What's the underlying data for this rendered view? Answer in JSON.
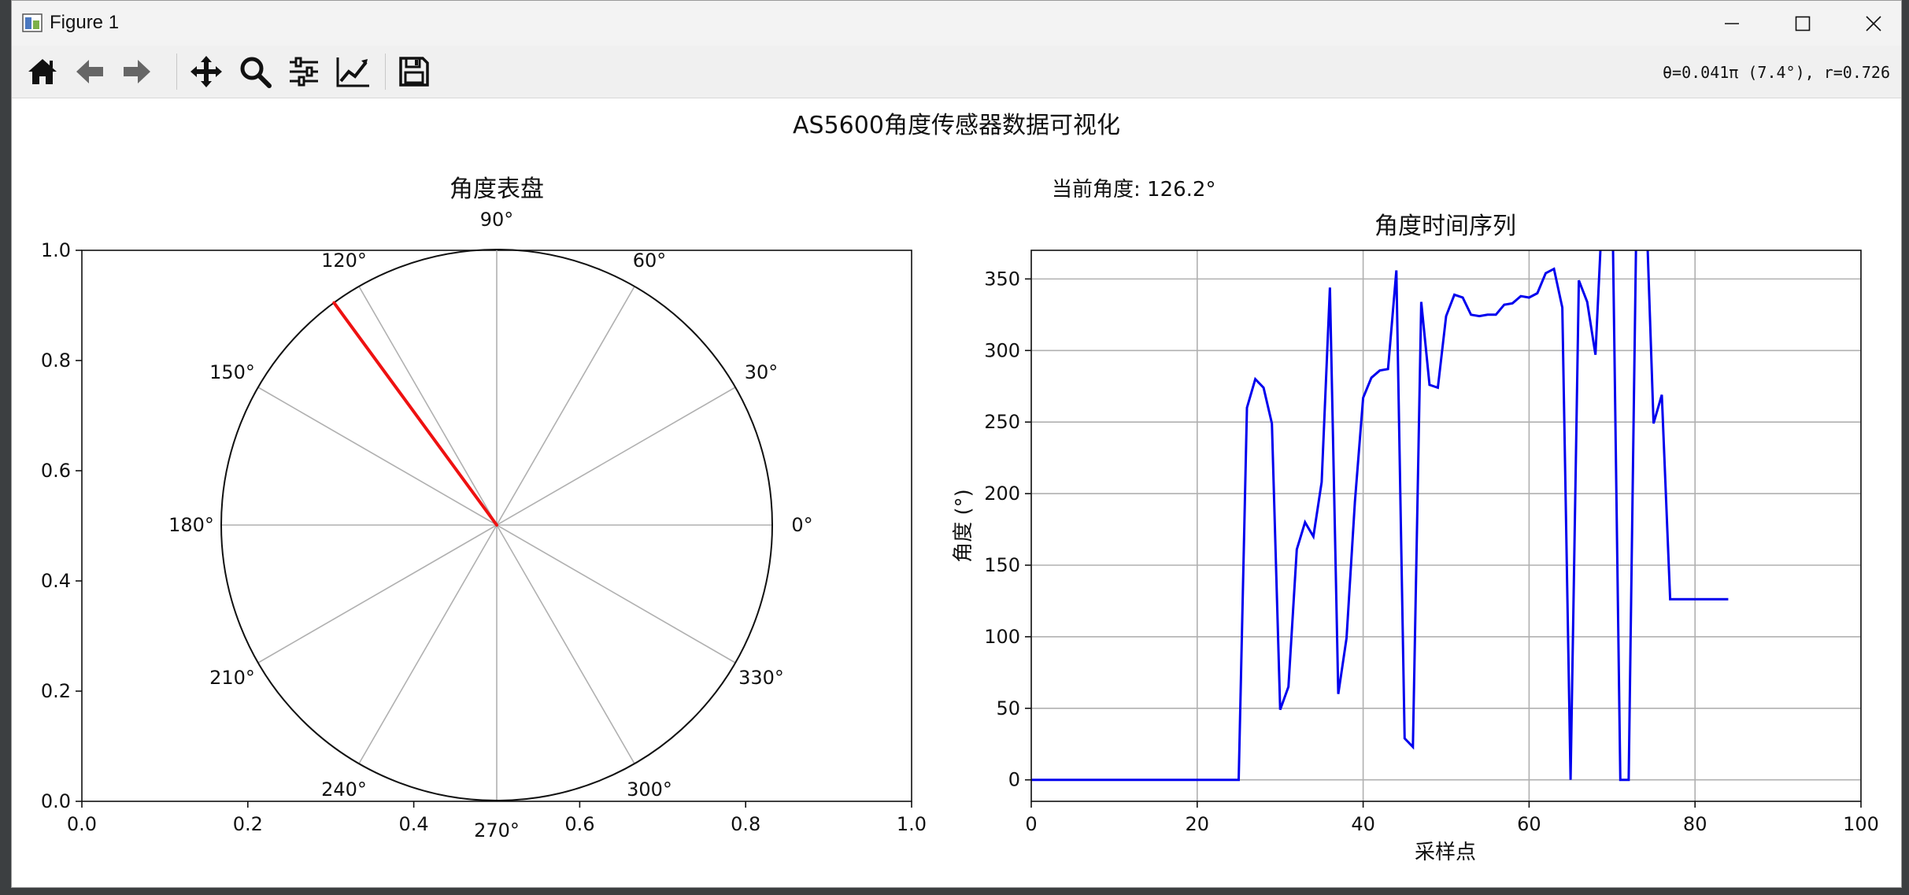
{
  "window": {
    "title": "Figure 1",
    "controls": {
      "minimize": "minimize",
      "maximize": "maximize",
      "close": "close"
    }
  },
  "toolbar": {
    "buttons": [
      {
        "name": "home-button",
        "icon": "home-icon"
      },
      {
        "name": "back-button",
        "icon": "arrow-left-icon"
      },
      {
        "name": "forward-button",
        "icon": "arrow-right-icon"
      },
      {
        "name": "pan-button",
        "icon": "move-icon"
      },
      {
        "name": "zoom-button",
        "icon": "magnifier-icon"
      },
      {
        "name": "subplots-button",
        "icon": "sliders-icon"
      },
      {
        "name": "axes-edit-button",
        "icon": "line-chart-icon"
      },
      {
        "name": "save-button",
        "icon": "floppy-disk-icon"
      }
    ],
    "coordinates": "θ=0.041π (7.4°), r=0.726"
  },
  "figure": {
    "suptitle": "AS5600角度传感器数据可视化",
    "current_angle_text": "当前角度: 126.2°"
  },
  "chart_data": [
    {
      "type": "polar-dial",
      "title": "角度表盘",
      "outer_axes_ticks": {
        "x": [
          "0.0",
          "0.2",
          "0.4",
          "0.6",
          "0.8",
          "1.0"
        ],
        "y": [
          "0.0",
          "0.2",
          "0.4",
          "0.6",
          "0.8",
          "1.0"
        ]
      },
      "angle_labels": [
        "0°",
        "30°",
        "60°",
        "90°",
        "120°",
        "150°",
        "180°",
        "210°",
        "240°",
        "270°",
        "300°",
        "330°"
      ],
      "angle_label_values": [
        0,
        30,
        60,
        90,
        120,
        150,
        180,
        210,
        240,
        270,
        300,
        330
      ],
      "radial_grid_angles": [
        0,
        30,
        60,
        90,
        120,
        150,
        180,
        210,
        240,
        270,
        300,
        330
      ],
      "needle": {
        "angle_deg": 126.2,
        "color": "#ee1111"
      },
      "grid": true
    },
    {
      "type": "line",
      "title": "角度时间序列",
      "xlabel": "采样点",
      "ylabel": "角度 (°)",
      "xlim": [
        0,
        100
      ],
      "ylim": [
        -15,
        370
      ],
      "xticks": [
        0,
        20,
        40,
        60,
        80,
        100
      ],
      "yticks": [
        0,
        50,
        100,
        150,
        200,
        250,
        300,
        350
      ],
      "grid": true,
      "series": [
        {
          "color": "#0000ee",
          "x": [
            0,
            1,
            2,
            3,
            4,
            5,
            6,
            7,
            8,
            9,
            10,
            11,
            12,
            13,
            14,
            15,
            16,
            17,
            18,
            19,
            20,
            21,
            22,
            23,
            24,
            25,
            26,
            27,
            28,
            29,
            30,
            31,
            32,
            33,
            34,
            35,
            36,
            37,
            38,
            39,
            40,
            41,
            42,
            43,
            44,
            45,
            46,
            47,
            48,
            49,
            50,
            51,
            52,
            53,
            54,
            55,
            56,
            57,
            58,
            59,
            60,
            61,
            62,
            63,
            64,
            65,
            66,
            67,
            68,
            69,
            70,
            71,
            72,
            73,
            74,
            75,
            76,
            77,
            78,
            79,
            80,
            81,
            82,
            83,
            84
          ],
          "y": [
            0,
            0,
            0,
            0,
            0,
            0,
            0,
            0,
            0,
            0,
            0,
            0,
            0,
            0,
            0,
            0,
            0,
            0,
            0,
            0,
            0,
            0,
            0,
            0,
            0,
            0,
            260,
            280,
            274,
            249,
            49,
            65,
            161,
            180,
            170,
            208,
            344,
            60,
            99,
            194,
            267,
            281,
            286,
            287,
            356,
            29,
            23,
            334,
            276,
            274,
            324,
            339,
            337,
            325,
            324,
            325,
            325,
            332,
            333,
            338,
            337,
            340,
            354,
            357,
            330,
            0,
            349,
            334,
            297,
            420,
            420,
            0,
            0,
            420,
            420,
            249,
            269,
            126.2,
            126.2,
            126.2,
            126.2,
            126.2,
            126.2,
            126.2,
            126.2
          ]
        }
      ]
    }
  ]
}
